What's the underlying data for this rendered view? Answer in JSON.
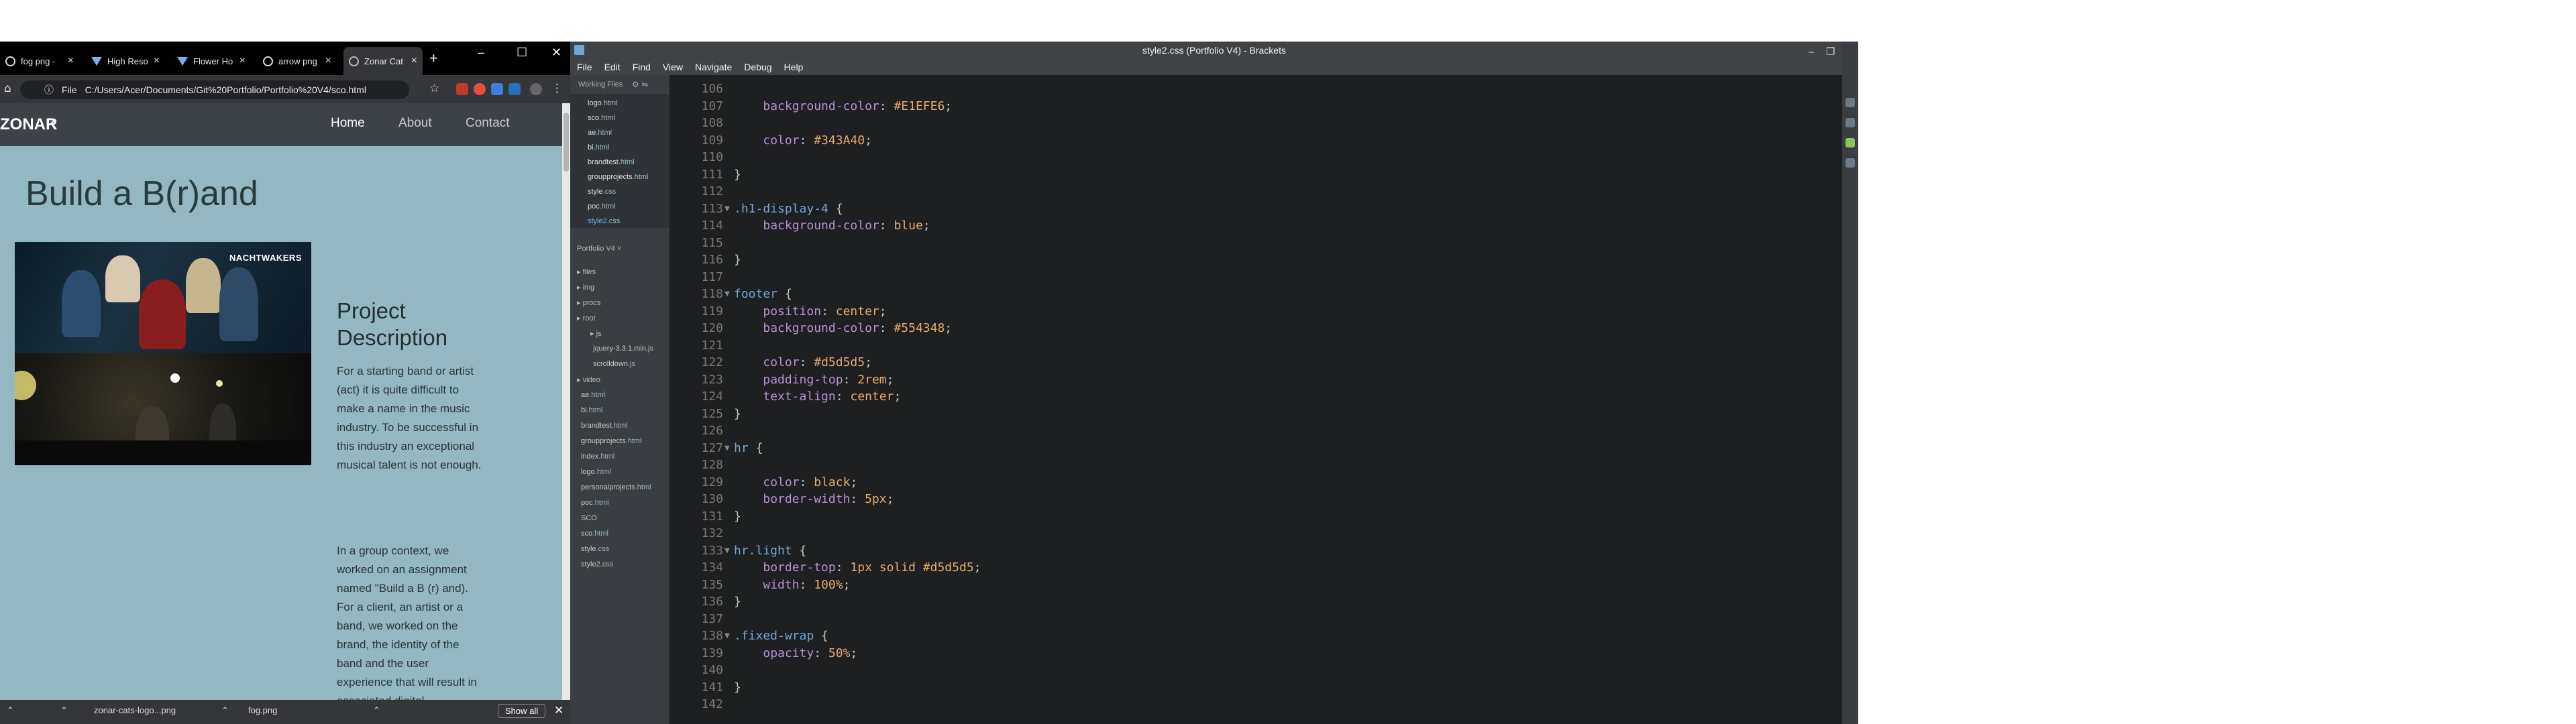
{
  "browser": {
    "tabs": [
      {
        "title": "fog png -",
        "active": false
      },
      {
        "title": "High Reso",
        "active": false
      },
      {
        "title": "Flower Ho",
        "active": false
      },
      {
        "title": "arrow png",
        "active": false
      },
      {
        "title": "Zonar Cat",
        "active": true
      }
    ],
    "address": {
      "scheme_label": "File",
      "url": "C:/Users/Acer/Documents/Git%20Portfolio/Portfolio%20V4/sco.html"
    },
    "page": {
      "brand": "ZONAR",
      "nav": [
        {
          "label": "Home",
          "active": true
        },
        {
          "label": "About",
          "active": false
        },
        {
          "label": "Contact",
          "active": false
        }
      ],
      "title": "Build a B(r)and",
      "image_logo": "NACHTWAKERS",
      "description_title": "Project Description",
      "paragraph1": "For a starting band or artist (act) it is quite difficult to make a name in the music industry. To be successful in this industry an exceptional musical talent is not enough.",
      "paragraph2": "In a group context, we worked on an assignment named \"Build a B (r) and). For a client, an artist or a band, we worked on the brand, the identity of the band and the user experience that will result in associated digital"
    },
    "downloads": [
      {
        "name": "zonar-cats-logo...png"
      },
      {
        "name": "fog.png"
      }
    ],
    "show_all": "Show all"
  },
  "brackets": {
    "title": "style2.css (Portfolio V4) - Brackets",
    "menu": [
      "File",
      "Edit",
      "Find",
      "View",
      "Navigate",
      "Debug",
      "Help"
    ],
    "sidebar": {
      "working_files_label": "Working Files",
      "working_files": [
        {
          "name": "logo",
          "ext": ".html",
          "selected": false
        },
        {
          "name": "sco",
          "ext": ".html",
          "selected": false
        },
        {
          "name": "ae",
          "ext": ".html",
          "selected": false
        },
        {
          "name": "bi",
          "ext": ".html",
          "selected": false
        },
        {
          "name": "brandtest",
          "ext": ".html",
          "selected": false
        },
        {
          "name": "groupprojects",
          "ext": ".html",
          "selected": false
        },
        {
          "name": "style",
          "ext": ".css",
          "selected": false
        },
        {
          "name": "poc",
          "ext": ".html",
          "selected": false
        },
        {
          "name": "style2",
          "ext": ".css",
          "selected": true
        }
      ],
      "project_label": "Portfolio V4 ˅",
      "tree": [
        {
          "name": "files",
          "ext": "",
          "folder": true
        },
        {
          "name": "img",
          "ext": "",
          "folder": true
        },
        {
          "name": "procs",
          "ext": "",
          "folder": true
        },
        {
          "name": "root",
          "ext": "",
          "folder": true
        },
        {
          "name": "js",
          "ext": "",
          "folder": true
        },
        {
          "name": "jquery-3.3.1.min",
          "ext": ".js",
          "folder": false
        },
        {
          "name": "scrolldown",
          "ext": ".js",
          "folder": false
        },
        {
          "name": "video",
          "ext": "",
          "folder": true
        },
        {
          "name": "ae",
          "ext": ".html",
          "folder": false
        },
        {
          "name": "bi",
          "ext": ".html",
          "folder": false
        },
        {
          "name": "brandtest",
          "ext": ".html",
          "folder": false
        },
        {
          "name": "groupprojects",
          "ext": ".html",
          "folder": false
        },
        {
          "name": "index",
          "ext": ".html",
          "folder": false
        },
        {
          "name": "logo",
          "ext": ".html",
          "folder": false
        },
        {
          "name": "personalprojects",
          "ext": ".html",
          "folder": false
        },
        {
          "name": "poc",
          "ext": ".html",
          "folder": false
        },
        {
          "name": "SCO",
          "ext": "",
          "folder": false
        },
        {
          "name": "sco",
          "ext": ".html",
          "folder": false
        },
        {
          "name": "style",
          "ext": ".css",
          "folder": false
        },
        {
          "name": "style2",
          "ext": ".css",
          "folder": false
        }
      ]
    },
    "code_lines": [
      {
        "n": "106",
        "fold": false,
        "t": ""
      },
      {
        "n": "107",
        "fold": false,
        "t": "    background-color: #E1EFE6;"
      },
      {
        "n": "108",
        "fold": false,
        "t": ""
      },
      {
        "n": "109",
        "fold": false,
        "t": "    color: #343A40;"
      },
      {
        "n": "110",
        "fold": false,
        "t": ""
      },
      {
        "n": "111",
        "fold": false,
        "t": "}"
      },
      {
        "n": "112",
        "fold": false,
        "t": ""
      },
      {
        "n": "113",
        "fold": true,
        "t": ".h1-display-4 {"
      },
      {
        "n": "114",
        "fold": false,
        "t": "    background-color: blue;"
      },
      {
        "n": "115",
        "fold": false,
        "t": ""
      },
      {
        "n": "116",
        "fold": false,
        "t": "}"
      },
      {
        "n": "117",
        "fold": false,
        "t": ""
      },
      {
        "n": "118",
        "fold": true,
        "t": "footer {"
      },
      {
        "n": "119",
        "fold": false,
        "t": "    position: center;"
      },
      {
        "n": "120",
        "fold": false,
        "t": "    background-color: #554348;"
      },
      {
        "n": "121",
        "fold": false,
        "t": ""
      },
      {
        "n": "122",
        "fold": false,
        "t": "    color: #d5d5d5;"
      },
      {
        "n": "123",
        "fold": false,
        "t": "    padding-top: 2rem;"
      },
      {
        "n": "124",
        "fold": false,
        "t": "    text-align: center;"
      },
      {
        "n": "125",
        "fold": false,
        "t": "}"
      },
      {
        "n": "126",
        "fold": false,
        "t": ""
      },
      {
        "n": "127",
        "fold": true,
        "t": "hr {"
      },
      {
        "n": "128",
        "fold": false,
        "t": ""
      },
      {
        "n": "129",
        "fold": false,
        "t": "    color: black;"
      },
      {
        "n": "130",
        "fold": false,
        "t": "    border-width: 5px;"
      },
      {
        "n": "131",
        "fold": false,
        "t": "}"
      },
      {
        "n": "132",
        "fold": false,
        "t": ""
      },
      {
        "n": "133",
        "fold": true,
        "t": "hr.light {"
      },
      {
        "n": "134",
        "fold": false,
        "t": "    border-top: 1px solid #d5d5d5;"
      },
      {
        "n": "135",
        "fold": false,
        "t": "    width: 100%;"
      },
      {
        "n": "136",
        "fold": false,
        "t": "}"
      },
      {
        "n": "137",
        "fold": false,
        "t": ""
      },
      {
        "n": "138",
        "fold": true,
        "t": ".fixed-wrap {"
      },
      {
        "n": "139",
        "fold": false,
        "t": "    opacity: 50%;"
      },
      {
        "n": "140",
        "fold": false,
        "t": ""
      },
      {
        "n": "141",
        "fold": false,
        "t": "}"
      },
      {
        "n": "142",
        "fold": false,
        "t": ""
      }
    ]
  },
  "colors": {
    "browser_page_bg": "#93b8c2",
    "browser_nav_bg": "#3d4248",
    "editor_bg": "#1d1f21",
    "selector": "#73a7d8",
    "property": "#ba8fd6",
    "value": "#e5a96b"
  }
}
